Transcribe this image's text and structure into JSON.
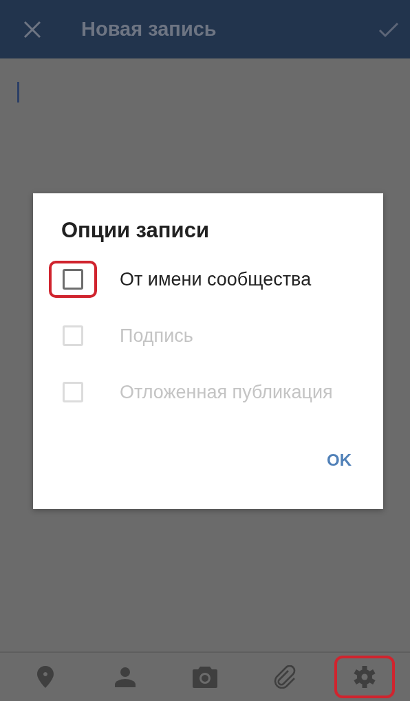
{
  "app_bar": {
    "title": "Новая запись"
  },
  "dialog": {
    "title": "Опции записи",
    "options": [
      {
        "label": "От имени сообщества",
        "checked": false,
        "disabled": false,
        "highlighted": true
      },
      {
        "label": "Подпись",
        "checked": false,
        "disabled": true,
        "highlighted": false
      },
      {
        "label": "Отложенная публикация",
        "checked": false,
        "disabled": true,
        "highlighted": false
      }
    ],
    "ok_button": "OK"
  },
  "toolbar": [
    {
      "kind": "location",
      "highlighted": false
    },
    {
      "kind": "person",
      "highlighted": false
    },
    {
      "kind": "camera",
      "highlighted": false
    },
    {
      "kind": "attach",
      "highlighted": false
    },
    {
      "kind": "settings",
      "highlighted": true
    }
  ]
}
